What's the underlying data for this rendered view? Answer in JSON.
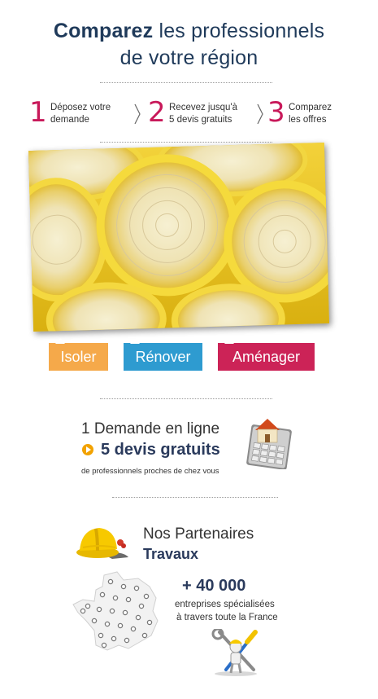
{
  "header": {
    "title_bold": "Comparez",
    "title_rest": "les professionnels",
    "title_line2": "de votre région"
  },
  "steps": [
    {
      "num": "1",
      "line1": "Déposez votre",
      "line2": "demande"
    },
    {
      "num": "2",
      "line1": "Recevez jusqu'à",
      "line2": "5 devis gratuits"
    },
    {
      "num": "3",
      "line1": "Comparez",
      "line2": "les offres"
    }
  ],
  "categories": [
    {
      "label": "Isoler",
      "color": "#f5a94a"
    },
    {
      "label": "Rénover",
      "color": "#2e9bd0"
    },
    {
      "label": "Aménager",
      "color": "#cc2357"
    }
  ],
  "demand": {
    "line1": "1 Demande en ligne",
    "line2": "5 devis gratuits",
    "line3": "de professionnels proches de chez vous"
  },
  "partners": {
    "line1": "Nos Partenaires",
    "line2": "Travaux",
    "count": "+ 40 000",
    "desc_line1": "entreprises spécialisées",
    "desc_line2": "à travers toute la France"
  },
  "icons": {
    "photo": "insulation-rolls-photo",
    "calculator": "house-calculator-icon",
    "helmet": "hard-hat-icon",
    "map": "france-map-icon",
    "worker": "worker-with-tools-icon"
  },
  "colors": {
    "navy": "#1f3a5a",
    "magenta": "#c8195a",
    "orange": "#f2a200"
  }
}
